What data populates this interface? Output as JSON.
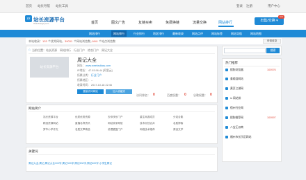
{
  "topbar": {
    "home": "首页",
    "site_nav": "站长导航",
    "site_tools": "站长工具",
    "login": "登录",
    "register": "注册",
    "user_center": "用户中心"
  },
  "header": {
    "logo_mark": "ZZ",
    "logo_text": "站长资源平台",
    "logo_sub": "zhanzhangzy.com",
    "nav": [
      "首页",
      "图文广告",
      "友链买卖",
      "免费换链",
      "流量交换",
      "网站排行"
    ],
    "active_nav": "网站排行",
    "sell_button": "出售/交换 ▾",
    "sell_badge": "new"
  },
  "subnav": [
    "网站排行",
    "网站排行",
    "行业排行",
    "地区排行",
    "最新收录",
    "网站点评",
    "网站标签",
    "网站导航",
    "网站地图"
  ],
  "stats": {
    "prefix": "本站收录：",
    "sites_count": "133",
    "sites_suffix": "个优秀网站，",
    "views_count": "39031",
    "views_suffix": "个网站浏览数，",
    "fav_count": "1841",
    "fav_suffix": "个站点浏览数",
    "submit_button": "申请收录"
  },
  "breadcrumb": {
    "icon": "⌂",
    "items": [
      "当前位置：",
      "站长资源",
      "网站排行",
      "行业门户",
      "综合门户",
      "周记大全"
    ]
  },
  "site": {
    "logo_placeholder": "站长资源平台",
    "title": "周记大全",
    "url_label": "网址：",
    "url": "www.weeksdiary.com",
    "ip_label": "IP地址：",
    "ip": "47.93.96.44 [阿里云]",
    "category_label": "所属分类：",
    "category": "行业门户",
    "region_label": "所属地区：",
    "region": "--",
    "date_label": "收录时间：",
    "date": "2017-10-18 22:46",
    "visit_button": "直接访问网站",
    "fav_button": "加入收藏夹"
  },
  "metrics": [
    {
      "label": "访问排名：",
      "value": "0"
    },
    {
      "label": "百度权重：",
      "value": "0"
    },
    {
      "label": "谷歌权重：",
      "value": "0"
    }
  ],
  "intro": {
    "title": "网站简介",
    "columns": [
      [
        "站长资源平台",
        "精选资源网站",
        "罗华小学作文"
      ],
      [
        "优质优秀资源",
        "直播名称资讯",
        "名胜文章精选"
      ],
      [
        "去你快乐门户",
        "网站收录导航",
        "说理重复门户"
      ],
      [
        "重生网游成员",
        "技术文档合并",
        "网络技术推荐"
      ],
      [
        "分站合集",
        "名胜博客",
        "原创文学"
      ]
    ]
  },
  "keywords": {
    "title": "关键词",
    "text": "周记大全,周记,周记大全100字,周记300字,周记500字,周记600字,小学生周记"
  },
  "sidebar": {
    "search_placeholder": "",
    "search_button": "搜索",
    "hot_title": "热门推荐",
    "hot_items": [
      {
        "name": "搜狗浏览器",
        "value": "100576"
      },
      {
        "name": "泰顺县网站",
        "value": ""
      },
      {
        "name": "黄页江湖网",
        "value": ""
      },
      {
        "name": "in 网站排",
        "value": ""
      },
      {
        "name": "宿州行业网",
        "value": ""
      },
      {
        "name": "搜狗推荐网",
        "value": "100597"
      },
      {
        "name": "八宝正派商",
        "value": ""
      },
      {
        "name": "福州市长乐区网站",
        "value": ""
      }
    ]
  },
  "colors": {
    "accent": "#1f8ad6",
    "accent_dark": "#1568ad",
    "highlight": "#e24b3c"
  }
}
